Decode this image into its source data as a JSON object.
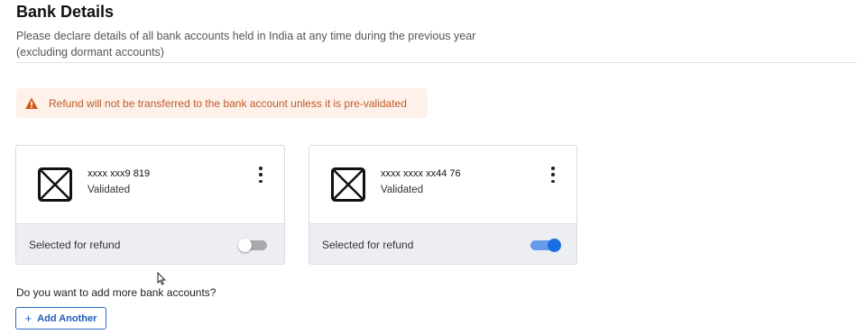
{
  "header": {
    "title": "Bank Details",
    "subtitle_line1": "Please declare details of all bank accounts held in India at any time during the previous year",
    "subtitle_line2": "(excluding dormant accounts)"
  },
  "alert": {
    "icon": "warning-triangle-icon",
    "color": "#c25a26",
    "text": "Refund will not be transferred to the bank account unless it is pre-validated"
  },
  "accounts": [
    {
      "icon": "bank-placeholder-icon",
      "number": "xxxx xxx9 819",
      "status": "Validated",
      "refund_label": "Selected for refund",
      "selected_for_refund": false
    },
    {
      "icon": "bank-placeholder-icon",
      "number": "xxxx xxxx xx44 76",
      "status": "Validated",
      "refund_label": "Selected for refund",
      "selected_for_refund": true
    }
  ],
  "add_more": {
    "question": "Do you want to add more bank accounts?",
    "button_plus": "+",
    "button_label": "Add Another"
  },
  "colors": {
    "accent": "#1a6fe0",
    "alert_bg": "#fdf1ea"
  }
}
